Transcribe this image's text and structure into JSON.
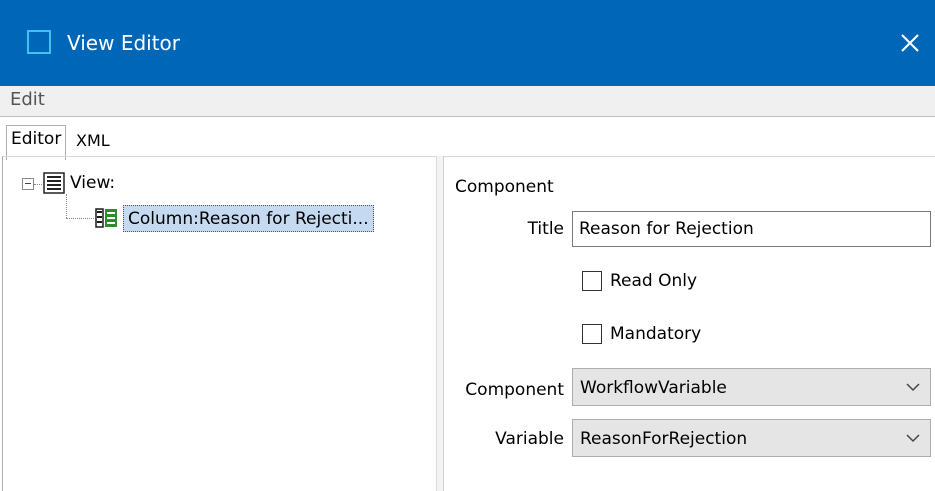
{
  "window": {
    "title": "View Editor",
    "accent": "#0067b8"
  },
  "menu": {
    "items": [
      "Edit"
    ]
  },
  "tabs": [
    {
      "label": "Editor",
      "active": true
    },
    {
      "label": "XML",
      "active": false
    }
  ],
  "tree": {
    "root": {
      "label": "View:",
      "icon": "view-list-icon",
      "expanded": true
    },
    "children": [
      {
        "label": "Column:Reason for Rejecti...",
        "icon": "column-icon",
        "selected": true
      }
    ]
  },
  "form": {
    "section": "Component",
    "title_label": "Title",
    "title_value": "Reason for Rejection",
    "read_only_label": "Read Only",
    "read_only_checked": false,
    "mandatory_label": "Mandatory",
    "mandatory_checked": false,
    "component_label": "Component",
    "component_value": "WorkflowVariable",
    "variable_label": "Variable",
    "variable_value": "ReasonForRejection"
  }
}
